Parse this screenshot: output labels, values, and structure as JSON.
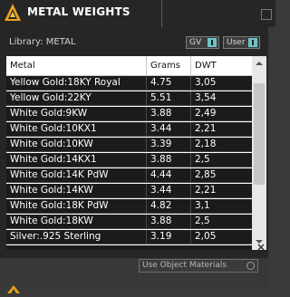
{
  "window": {
    "title": "METAL WEIGHTS"
  },
  "library": {
    "label": "Library: METAL"
  },
  "toggles": {
    "gv_label": "GV",
    "user_label": "User"
  },
  "table": {
    "headers": [
      "Metal",
      "Grams",
      "DWT"
    ],
    "rows": [
      [
        "Yellow Gold:18KY Royal",
        "4.75",
        "3,05"
      ],
      [
        "Yellow Gold:22KY",
        "5.51",
        "3,54"
      ],
      [
        "White Gold:9KW",
        "3.88",
        "2,49"
      ],
      [
        "White Gold:10KX1",
        "3.44",
        "2,21"
      ],
      [
        "White Gold:10KW",
        "3.39",
        "2,18"
      ],
      [
        "White Gold:14KX1",
        "3.88",
        "2,5"
      ],
      [
        "White Gold:14K PdW",
        "4.44",
        "2,85"
      ],
      [
        "White Gold:14KW",
        "3.44",
        "2,21"
      ],
      [
        "White Gold:18K PdW",
        "4.82",
        "3,1"
      ],
      [
        "White Gold:18KW",
        "3.88",
        "2,5"
      ],
      [
        "Silver:.925 Sterling",
        "3.19",
        "2,05"
      ]
    ]
  },
  "footer": {
    "use_object_materials_label": "Use Object Materials"
  },
  "colors": {
    "accent": "#6ec3c9",
    "logo": "#e8a31c"
  },
  "icons": {
    "logo": "app-logo-icon",
    "scroll_up": "chevron-up-icon",
    "scroll_down": "chevron-down-icon",
    "close": "close-icon"
  }
}
